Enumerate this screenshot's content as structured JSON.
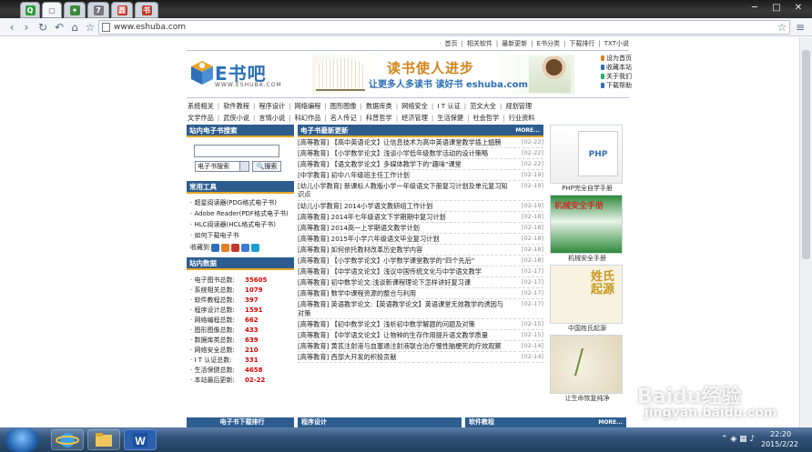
{
  "browser": {
    "tabs": [
      {
        "icon": "Q",
        "color": "#2b9c3a"
      },
      {
        "icon": "▢",
        "color": "#8a8a8a"
      },
      {
        "icon": "✦",
        "color": "#3a8a3a"
      },
      {
        "icon": "7",
        "color": "#777777"
      },
      {
        "icon": "圆",
        "color": "#c0392b"
      },
      {
        "icon": "书",
        "color": "#c0392b"
      }
    ],
    "window_controls": [
      "─",
      "□",
      "✕"
    ],
    "nav": {
      "back": "‹",
      "forward": "›",
      "reload": "↻",
      "home": "⌂",
      "star": "☆",
      "menu": "≡"
    },
    "url": "www.eshuba.com",
    "star_right": "☆"
  },
  "site": {
    "top_nav": [
      "首页",
      "相关软件",
      "最新更新",
      "E书分类",
      "下载排行",
      "TXT小说"
    ],
    "logo": {
      "name": "E书吧",
      "domain": "WWW.ESHUBA.COM"
    },
    "banner": {
      "slogan": "读书使人进步",
      "tagline": "让更多人多读书 读好书 eshuba.com"
    },
    "quick_links": [
      {
        "label": "设为首页",
        "color": "#e67e22"
      },
      {
        "label": "收藏本站",
        "color": "#2e70b8"
      },
      {
        "label": "关于我们",
        "color": "#27ae60"
      },
      {
        "label": "下载帮助",
        "color": "#2e70b8"
      }
    ],
    "categories_row1": [
      "系统相关",
      "软件教程",
      "程序设计",
      "网络编程",
      "图形图像",
      "数据库类",
      "网络安全",
      "I T 认证",
      "范文大全",
      "规划管理"
    ],
    "categories_row2": [
      "文学作品",
      "武侠小说",
      "言情小说",
      "科幻作品",
      "名人传记",
      "科普哲学",
      "经济管理",
      "生活保健",
      "社会哲学",
      "行业资料"
    ]
  },
  "left": {
    "search": {
      "title": "站内电子书搜索",
      "select": "电子书搜索",
      "button": "搜索"
    },
    "tools": {
      "title": "常用工具",
      "items": [
        "· 超星阅读器(PDG格式电子书)",
        "· Adobe Reader(PDF格式电子书)",
        "· HLC阅读器(HCL格式电子书)",
        "· 如何下载电子书"
      ],
      "fav_label": "收藏到"
    },
    "stats": {
      "title": "站内数据",
      "rows": [
        {
          "k": "· 电子图书总数:",
          "v": "35605"
        },
        {
          "k": "· 系统相关总数:",
          "v": "1079"
        },
        {
          "k": "· 软件教程总数:",
          "v": "397"
        },
        {
          "k": "· 程序设计总数:",
          "v": "1591"
        },
        {
          "k": "· 网络编程总数:",
          "v": "662"
        },
        {
          "k": "· 图形图像总数:",
          "v": "433"
        },
        {
          "k": "· 数据库类总数:",
          "v": "639"
        },
        {
          "k": "· 网络安全总数:",
          "v": "210"
        },
        {
          "k": "· I T 认证总数:",
          "v": "331"
        },
        {
          "k": "· 生活保健总数:",
          "v": "4658"
        },
        {
          "k": "· 本站最后更新:",
          "v": "02-22"
        }
      ]
    },
    "bottom_title": "电子书下载排行"
  },
  "main": {
    "title": "电子书最新更新",
    "more": "MORE...",
    "items": [
      {
        "t": "[高等教育] 【高中英语论文】让信息技术为高中英语课堂教学插上翅膀",
        "d": "[02-22]"
      },
      {
        "t": "[高等教育] 【小学数学论文】浅谈小学低年级数学活动的设计策略",
        "d": "[02-22]"
      },
      {
        "t": "[高等教育] 【语文教学论文】多媒体教学下的\"趣味\"课堂",
        "d": "[02-22]"
      },
      {
        "t": "[中学教育] 初中八年级班主任工作计划",
        "d": "[02-19]"
      },
      {
        "t": "[幼儿小学教育] 新课标人教版小学一年级语文下册复习计划及单元复习知识点",
        "d": "[02-19]"
      },
      {
        "t": "[幼儿小学教育] 2014小学语文教研组工作计划",
        "d": "[02-19]"
      },
      {
        "t": "[高等教育] 2014年七年级语文下学期期中复习计划",
        "d": "[02-18]"
      },
      {
        "t": "[高等教育] 2014高一上学期语文教学计划",
        "d": "[02-18]"
      },
      {
        "t": "[高等教育] 2015年小学六年级语文毕业复习计划",
        "d": "[02-18]"
      },
      {
        "t": "[高等教育] 如何依托教材改革历史教学内容",
        "d": "[02-18]"
      },
      {
        "t": "[高等教育] 【小学数学论文】小学数学课堂教学的\"四个先后\"",
        "d": "[02-18]"
      },
      {
        "t": "[高等教育] 【中学语文论文】浅议中国传统文化与中学语文教学",
        "d": "[02-17]"
      },
      {
        "t": "[高等教育] 初中数学论文:浅谈新课程理论下怎样讲好复习课",
        "d": "[02-17]"
      },
      {
        "t": "[高等教育] 数学中课程资源的整合与利用",
        "d": "[02-17]"
      },
      {
        "t": "[高等教育] 英语教学论文:【英语教学论文】英语课堂无效教学的诱因与对策",
        "d": "[02-17]"
      },
      {
        "t": "[高等教育] 【初中数学论文】浅析初中数学解题的问题及对策",
        "d": "[02-15]"
      },
      {
        "t": "[高等教育] 【中学语文论文】让物种的生存作用提升语文教学质量",
        "d": "[02-15]"
      },
      {
        "t": "[高等教育] 黄芪注射液与血塞通注射液联合治疗慢性脑梗死的疗效观察",
        "d": "[02-14]"
      },
      {
        "t": "[高等教育] 西部大开发的积极贡献",
        "d": "[02-14]"
      }
    ],
    "bottom_left": "程序设计",
    "bottom_right": "软件教程",
    "bottom_more": "MORE..."
  },
  "right": {
    "books": [
      {
        "caption": "PHP完全自学手册",
        "cover": "PHP"
      },
      {
        "caption": "机械安全手册",
        "cover": "机械安全手册"
      },
      {
        "caption": "中国姓氏起源",
        "cover": "姓氏起源"
      },
      {
        "caption": "让生命恢复纯净",
        "cover": ""
      }
    ]
  },
  "taskbar": {
    "time": "22:20",
    "date": "2015/2/22",
    "watermark": "Baidu经验",
    "watermark_url": "jingyan.baidu.com"
  }
}
